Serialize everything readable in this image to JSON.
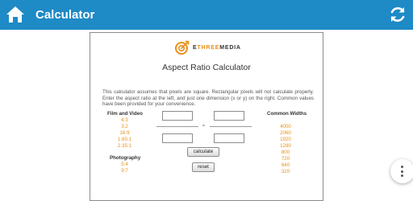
{
  "appbar": {
    "title": "Calculator"
  },
  "logo": {
    "prefix": "E",
    "brand": "THREE",
    "suffix": "MEDIA"
  },
  "calculator": {
    "title": "Aspect Ratio Calculator",
    "description": "This calculator assumes that pixels are square. Rectangular pixels will not calculate properly. Enter the aspect ratio at the left, and just one dimension (x or y) on the right. Common values have been provided for your convenience.",
    "film_video": {
      "heading": "Film and Video",
      "items": [
        "4:3",
        "3:2",
        "16:9",
        "1.85:1",
        "2.35:1"
      ]
    },
    "photography": {
      "heading": "Photography",
      "items": [
        "5:4",
        "9:7"
      ]
    },
    "common_widths": {
      "heading": "Common Widths",
      "items": [
        "4000",
        "2060",
        "1920",
        "1280",
        "800",
        "720",
        "640",
        "320"
      ]
    },
    "equals": "=",
    "calculate_label": "calculate",
    "reset_label": "reset"
  },
  "colors": {
    "appbar": "#1e8ac6",
    "accent": "#e8901c"
  },
  "icons": {
    "home": "home-icon",
    "refresh": "refresh-icon",
    "more": "more-vertical-icon",
    "logo": "ethree-logo-icon"
  }
}
